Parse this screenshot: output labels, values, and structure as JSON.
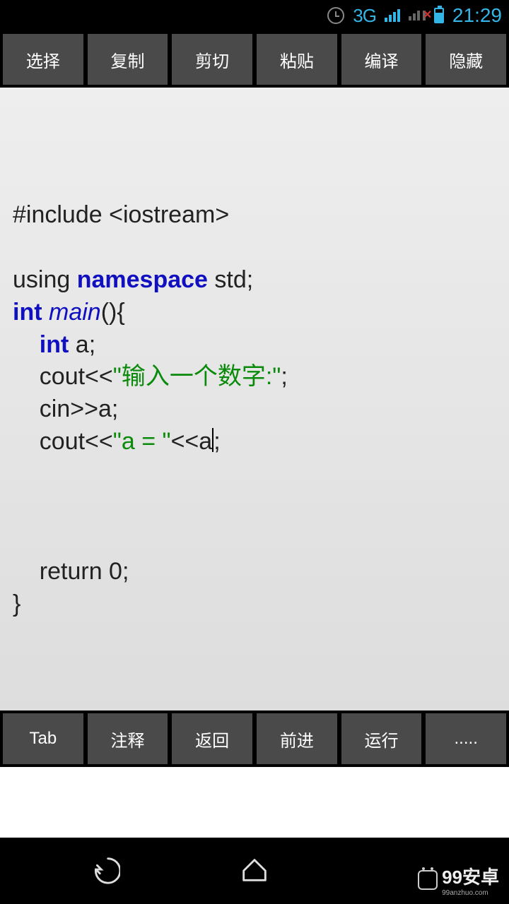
{
  "statusbar": {
    "network": "3G",
    "time": "21:29"
  },
  "toolbar_top": {
    "select": "选择",
    "copy": "复制",
    "cut": "剪切",
    "paste": "粘贴",
    "compile": "编译",
    "hide": "隐藏"
  },
  "code": {
    "include": "#include <iostream>",
    "using_pre": "using ",
    "using_kw": "namespace",
    "using_post": " std;",
    "int_kw": "int",
    "main_fn": " main",
    "main_post": "(){",
    "decl_pre": "    ",
    "decl_kw": "int",
    "decl_post": " a;",
    "cout1_pre": "    cout<<",
    "cout1_str": "\"输入一个数字:\"",
    "cout1_post": ";",
    "cin": "    cin>>a;",
    "cout2_pre": "    cout<<",
    "cout2_str": "\"a = \"",
    "cout2_mid": "<<a",
    "cout2_post": ";",
    "ret": "    return 0;",
    "close": "}"
  },
  "toolbar_bottom": {
    "tab": "Tab",
    "comment": "注释",
    "back": "返回",
    "forward": "前进",
    "run": "运行",
    "more": "....."
  },
  "brand": {
    "name": "99安卓",
    "url": "99anzhuo.com"
  }
}
